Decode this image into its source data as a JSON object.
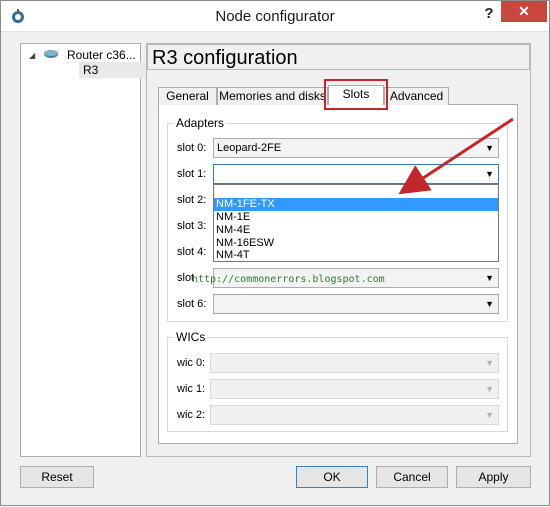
{
  "window": {
    "title": "Node configurator",
    "help_label": "?",
    "close_label": "✕"
  },
  "tree": {
    "router_label": "Router c36...",
    "child_label": "R3"
  },
  "header": {
    "title": "R3 configuration"
  },
  "tabs": [
    "General",
    "Memories and disks",
    "Slots",
    "Advanced"
  ],
  "adapters": {
    "title": "Adapters",
    "slots": [
      {
        "label": "slot 0:",
        "value": "Leopard-2FE"
      },
      {
        "label": "slot 1:",
        "value": ""
      },
      {
        "label": "slot 2:",
        "value": ""
      },
      {
        "label": "slot 3:",
        "value": ""
      },
      {
        "label": "slot 4:",
        "value": ""
      },
      {
        "label": "slot",
        "value": ""
      },
      {
        "label": "slot 6:",
        "value": ""
      }
    ],
    "dropdown_options": [
      "NM-1FE-TX",
      "NM-1E",
      "NM-4E",
      "NM-16ESW",
      "NM-4T"
    ],
    "dropdown_selected": "NM-1FE-TX"
  },
  "wics": {
    "title": "WICs",
    "items": [
      {
        "label": "wic 0:",
        "value": ""
      },
      {
        "label": "wic 1:",
        "value": ""
      },
      {
        "label": "wic 2:",
        "value": ""
      }
    ]
  },
  "watermark": "http://commonerrors.blogspot.com",
  "buttons": {
    "reset": "Reset",
    "ok": "OK",
    "cancel": "Cancel",
    "apply": "Apply"
  },
  "colors": {
    "highlight_box": "#c0282d",
    "annotation_arrow": "#c0282d",
    "selection": "#3399ff",
    "close_button": "#c7463d"
  },
  "icons": {
    "app": "gns3-app-icon",
    "router": "router-icon",
    "expand": "tree-expand-icon"
  }
}
